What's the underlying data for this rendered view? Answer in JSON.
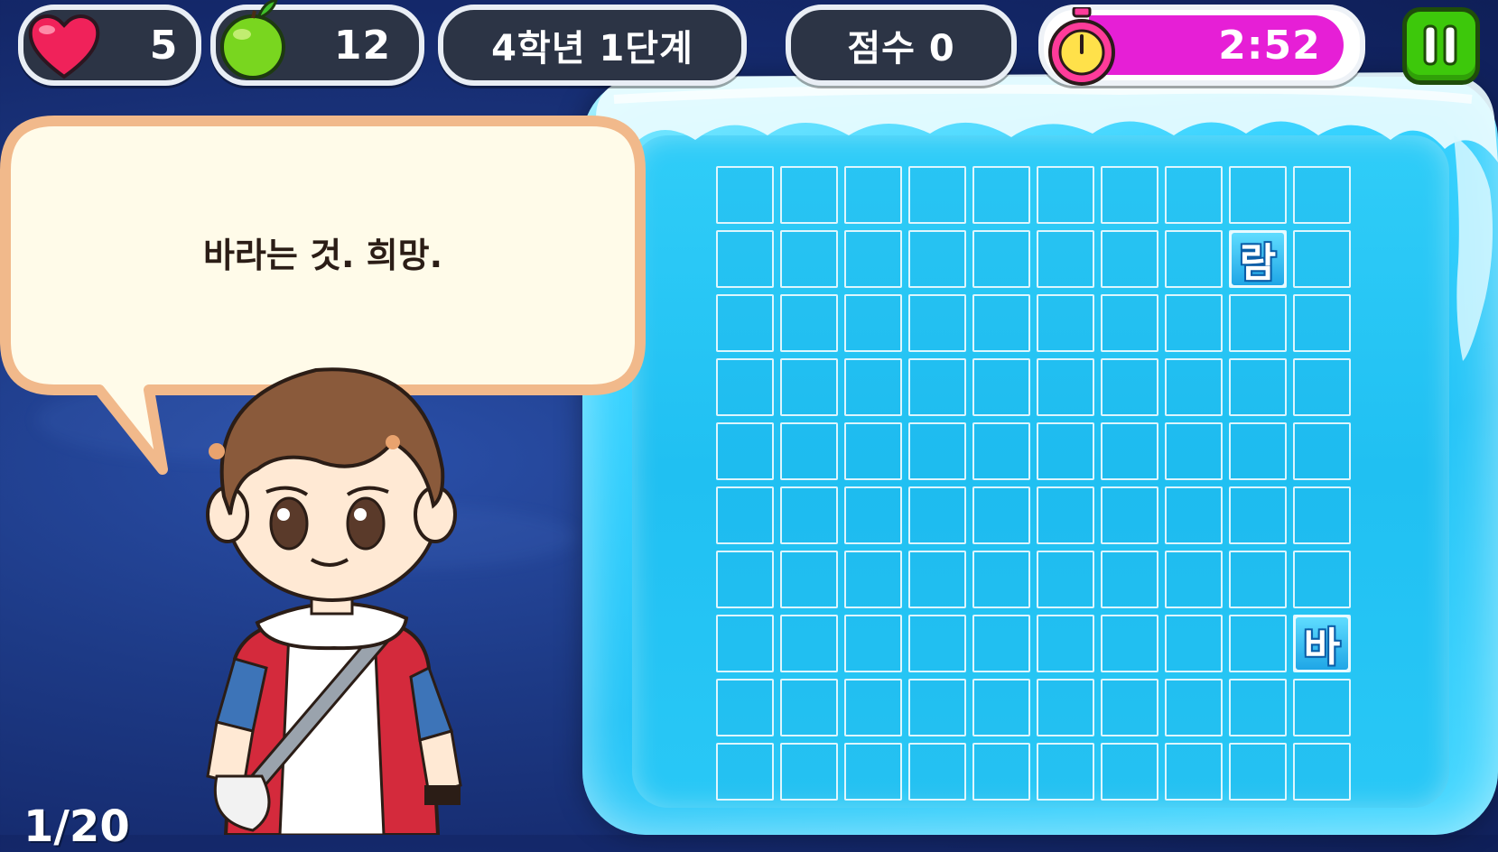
{
  "hud": {
    "lives": {
      "icon": "heart-icon",
      "value": "5"
    },
    "apples": {
      "icon": "apple-icon",
      "value": "12"
    },
    "level_label": "4학년 1단계",
    "score_label": "점수 0",
    "timer": {
      "icon": "stopwatch-icon",
      "value": "2:52",
      "remaining_fraction": 0.96
    },
    "pause": {
      "icon": "pause-icon"
    }
  },
  "speech": {
    "text": "바라는 것. 희망."
  },
  "progress_label": "1/20",
  "board": {
    "rows": 10,
    "cols": 10,
    "tiles": [
      {
        "row": 1,
        "col": 8,
        "char": "람"
      },
      {
        "row": 7,
        "col": 9,
        "char": "바"
      }
    ]
  },
  "colors": {
    "timer_fill": "#e61fd6",
    "pause_button": "#3dc80b",
    "ice": "#23c4f7",
    "bubble": "#fffbe9",
    "bubble_border": "#f1b98b"
  }
}
